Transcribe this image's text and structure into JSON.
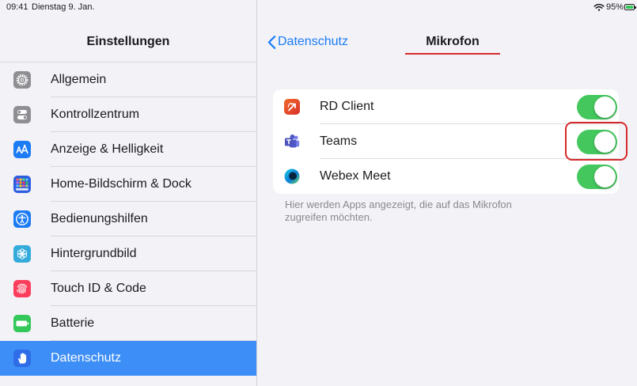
{
  "status_bar": {
    "time": "09:41",
    "date": "Dienstag 9. Jan.",
    "battery_text": "95%",
    "battery_level": 0.95,
    "battery_color": "#34c759",
    "wifi_icon": "wifi-icon",
    "battery_icon": "battery-icon"
  },
  "sidebar": {
    "title": "Einstellungen",
    "items": [
      {
        "label": "Allgemein",
        "icon": "gear-icon",
        "icon_color": "#8e8e93",
        "selected": false
      },
      {
        "label": "Kontrollzentrum",
        "icon": "control-center-icon",
        "icon_color": "#8e8e93",
        "selected": false
      },
      {
        "label": "Anzeige & Helligkeit",
        "icon": "text-size-icon",
        "icon_color": "#1c7cf4",
        "selected": false
      },
      {
        "label": "Home-Bildschirm & Dock",
        "icon": "home-screen-icon",
        "icon_color": "#2e5ee0",
        "selected": false
      },
      {
        "label": "Bedienungshilfen",
        "icon": "accessibility-icon",
        "icon_color": "#1c7cf4",
        "selected": false
      },
      {
        "label": "Hintergrundbild",
        "icon": "wallpaper-flower-icon",
        "icon_color": "#35abdb",
        "selected": false
      },
      {
        "label": "Touch ID & Code",
        "icon": "fingerprint-icon",
        "icon_color": "#fc3d5b",
        "selected": false
      },
      {
        "label": "Batterie",
        "icon": "battery-icon",
        "icon_color": "#34c759",
        "selected": false
      },
      {
        "label": "Datenschutz",
        "icon": "privacy-hand-icon",
        "icon_color": "#2f6de8",
        "selected": true
      }
    ]
  },
  "detail": {
    "back_label": "Datenschutz",
    "back_icon": "chevron-left-icon",
    "title": "Mikrofon",
    "apps": [
      {
        "name": "RD Client",
        "icon": "rd-client-icon",
        "enabled": true,
        "highlighted": false
      },
      {
        "name": "Teams",
        "icon": "teams-icon",
        "enabled": true,
        "highlighted": true
      },
      {
        "name": "Webex Meet",
        "icon": "webex-icon",
        "enabled": true,
        "highlighted": false
      }
    ],
    "footer": "Hier werden Apps angezeigt, die auf das Mikrofon zugreifen möchten."
  },
  "colors": {
    "accent": "#1a7cf5",
    "selection": "#3d8ef6",
    "toggle_on": "#44c85e",
    "annotation": "#d62a2a",
    "background": "#f2f2f7",
    "secondary_text": "#8a8a8e"
  }
}
